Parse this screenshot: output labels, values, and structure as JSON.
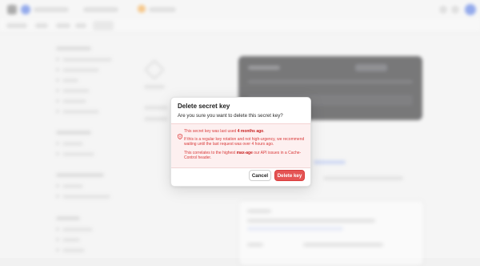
{
  "dialog": {
    "title": "Delete secret key",
    "subtitle": "Are you sure you want to delete this secret key?",
    "warning": {
      "icon": "shield-alert-icon",
      "line1_prefix": "This secret key was last used ",
      "line1_emphasis": "4 months ago",
      "line1_suffix": ".",
      "line2": "If this is a regular key rotation and not high-urgency, we recommend waiting until the last request was over 4 hours ago.",
      "line3_prefix": "This correlates to the highest ",
      "line3_emphasis": "max-age",
      "line3_suffix": " our API issues in a Cache-Control header."
    },
    "cancel_label": "Cancel",
    "delete_label": "Delete key"
  },
  "colors": {
    "danger": "#e45454",
    "warning_text": "#d93a3a",
    "warning_bg": "#fdf0f0"
  }
}
